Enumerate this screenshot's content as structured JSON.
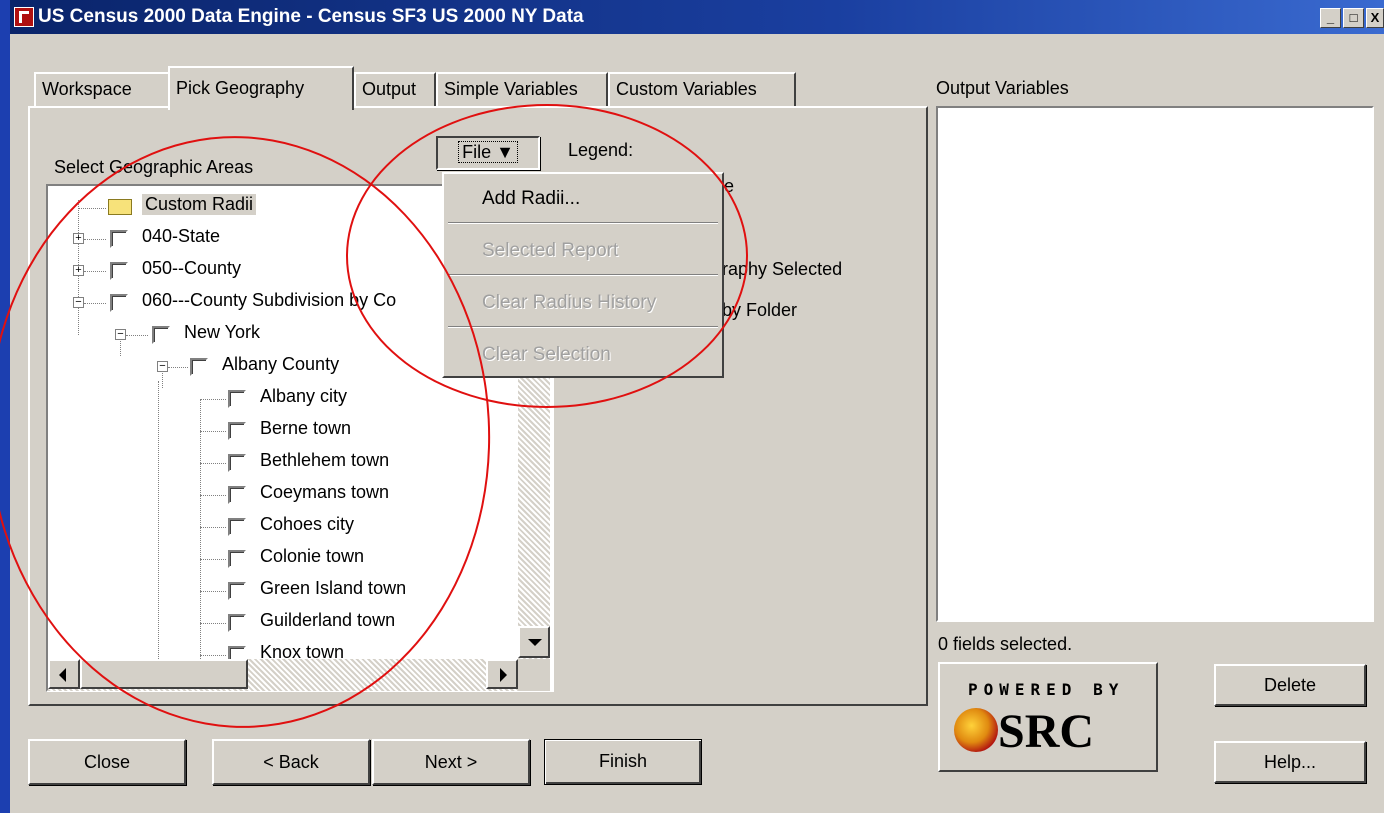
{
  "window": {
    "title": "US Census 2000 Data Engine - Census SF3 US 2000 NY Data",
    "minimize": "_",
    "maximize": "□",
    "close": "X"
  },
  "tabs": [
    {
      "label": "Workspace"
    },
    {
      "label": "Pick Geography"
    },
    {
      "label": "Output"
    },
    {
      "label": "Simple Variables"
    },
    {
      "label": "Custom Variables"
    }
  ],
  "geography": {
    "heading": "Select Geographic Areas",
    "tree": [
      {
        "label": "Custom Radii"
      },
      {
        "label": "040-State"
      },
      {
        "label": "050--County"
      },
      {
        "label": "060---County Subdivision by Co"
      },
      {
        "label": "New York"
      },
      {
        "label": "Albany County"
      },
      {
        "label": "Albany city"
      },
      {
        "label": "Berne town"
      },
      {
        "label": "Bethlehem town"
      },
      {
        "label": "Coeymans town"
      },
      {
        "label": "Cohoes city"
      },
      {
        "label": "Colonie town"
      },
      {
        "label": "Green Island town"
      },
      {
        "label": "Guilderland town"
      },
      {
        "label": "Knox town"
      }
    ]
  },
  "file_menu": {
    "button_label": "File ▼",
    "items": [
      {
        "label": "Add Radii...",
        "enabled": true
      },
      {
        "label": "Selected Report",
        "enabled": false
      },
      {
        "label": "Clear Radius History",
        "enabled": false
      },
      {
        "label": "Clear Selection",
        "enabled": false
      }
    ]
  },
  "legend": {
    "title": "Legend:",
    "fragments": [
      "le",
      "graphy Selected",
      "by Folder"
    ]
  },
  "output": {
    "heading": "Output Variables",
    "status": "0 fields selected.",
    "delete_label": "Delete",
    "help_label": "Help..."
  },
  "logo": {
    "powered_by": "POWERED BY",
    "brand": "SRC"
  },
  "footer": {
    "close_label": "Close",
    "back_label": "< Back",
    "next_label": "Next >",
    "finish_label": "Finish"
  },
  "colors": {
    "titlebar": "#0a246a",
    "face": "#d4d0c8",
    "annotation": "#e01010",
    "desktop": "#1c3fb0"
  }
}
